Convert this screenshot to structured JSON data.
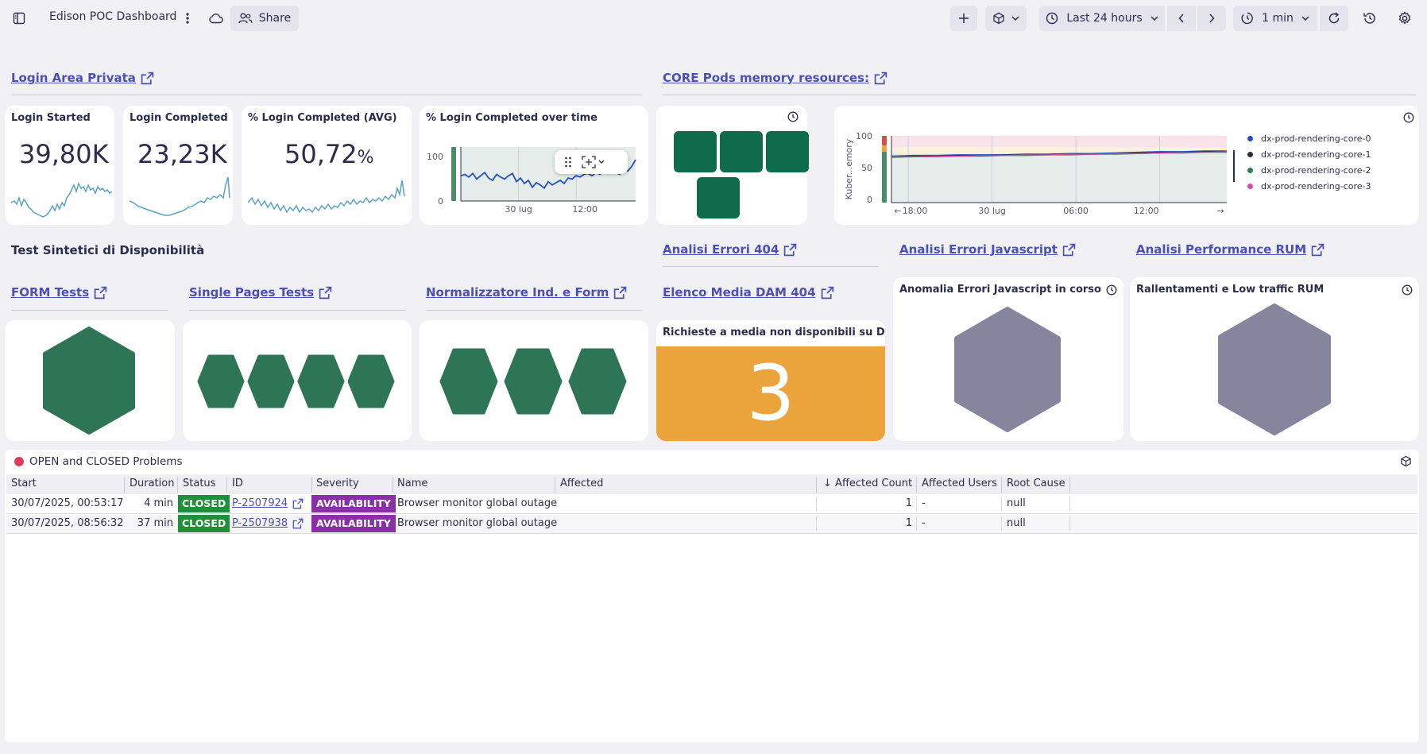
{
  "header": {
    "title": "Edison POC Dashboard",
    "share_label": "Share",
    "timeframe_label": "Last 24 hours",
    "refresh_interval_label": "1 min"
  },
  "sections": {
    "login": "Login Area Privata",
    "core_pods": "CORE Pods memory resources:",
    "synthetic": "Test Sintetici di Disponibilità",
    "errors_404": "Analisi Errori 404",
    "errors_js": "Analisi Errori Javascript",
    "rum": "Analisi Performance RUM",
    "form_tests": "FORM Tests",
    "single_pages": "Single Pages Tests",
    "normalizzatore": "Normalizzatore Ind. e Form",
    "media_dam": "Elenco Media DAM 404"
  },
  "tiles": {
    "login_started": {
      "title": "Login Started",
      "value": "39,80K"
    },
    "login_completed": {
      "title": "Login Completed",
      "value": "23,23K"
    },
    "login_pct": {
      "title": "% Login Completed (AVG)",
      "value": "50,72",
      "unit": "%"
    },
    "login_over_time": {
      "title": "% Login Completed over time"
    },
    "dam_media": {
      "title": "Richieste a media non disponibili su DAM",
      "value": "3"
    },
    "js_anomaly": {
      "title": "Anomalia Errori Javascript in corso"
    },
    "rum_slow": {
      "title": "Rallentamenti e Low traffic RUM"
    }
  },
  "chart_data": [
    {
      "type": "line",
      "title": "% Login Completed over time",
      "x_ticks": [
        "30 lug",
        "12:00"
      ],
      "y_ticks": [
        "0",
        "100"
      ],
      "ylim": [
        0,
        100
      ],
      "series": [
        {
          "values": [
            55,
            58,
            52,
            60,
            48,
            55,
            62,
            50,
            45,
            58,
            52,
            48,
            55,
            60,
            42,
            50,
            38,
            45,
            30,
            40,
            35,
            28,
            42,
            35,
            40,
            45,
            38,
            50,
            48,
            55,
            52,
            58,
            60,
            55,
            62,
            58,
            65,
            60,
            68,
            62,
            58,
            70,
            65,
            75,
            90
          ]
        }
      ]
    },
    {
      "type": "line",
      "title": "CORE Pods memory resources:",
      "ylabel": "Kuber...emory",
      "x_ticks": [
        "18:00",
        "30 lug",
        "06:00",
        "12:00"
      ],
      "y_ticks": [
        "0",
        "50",
        "100"
      ],
      "ylim": [
        0,
        100
      ],
      "series": [
        {
          "name": "dx-prod-rendering-core-0",
          "values": [
            68,
            69,
            69,
            70,
            70,
            70,
            71,
            71,
            72,
            72,
            73,
            74,
            75,
            75,
            76,
            76
          ]
        },
        {
          "name": "dx-prod-rendering-core-1",
          "values": [
            67,
            68,
            68,
            69,
            69,
            70,
            70,
            70,
            71,
            71,
            72,
            73,
            74,
            74,
            75,
            75
          ]
        },
        {
          "name": "dx-prod-rendering-core-2",
          "values": [
            66,
            67,
            67,
            68,
            68,
            69,
            69,
            70,
            70,
            71,
            71,
            72,
            73,
            73,
            74,
            74
          ]
        },
        {
          "name": "dx-prod-rendering-core-3",
          "values": [
            67,
            67,
            68,
            68,
            69,
            69,
            70,
            70,
            71,
            71,
            72,
            72,
            73,
            74,
            74,
            75
          ]
        }
      ]
    }
  ],
  "colors": {
    "green_dark": "#0e6b4c",
    "green_hex": "#2e7556",
    "grey_hex": "#85869d",
    "orange": "#eba33c",
    "link": "#4a50b8",
    "series": [
      "#1f4fbf",
      "#2c2d3a",
      "#2e7d55",
      "#d94aa8"
    ]
  },
  "problems": {
    "title": "OPEN and CLOSED Problems",
    "columns": [
      "Start",
      "Duration",
      "Status",
      "ID",
      "Severity",
      "Name",
      "Affected",
      "Affected Count",
      "Affected Users",
      "Root Cause"
    ],
    "sort_indicator": "↓",
    "rows": [
      {
        "start": "30/07/2025, 00:53:17",
        "duration": "4 min",
        "status": "CLOSED",
        "id": "P-2507924",
        "severity": "AVAILABILITY",
        "name": "Browser monitor global outage",
        "affected": "",
        "count": "1",
        "users": "-",
        "root_cause": "null"
      },
      {
        "start": "30/07/2025, 08:56:32",
        "duration": "37 min",
        "status": "CLOSED",
        "id": "P-2507938",
        "severity": "AVAILABILITY",
        "name": "Browser monitor global outage",
        "affected": "",
        "count": "1",
        "users": "-",
        "root_cause": "null"
      }
    ]
  }
}
